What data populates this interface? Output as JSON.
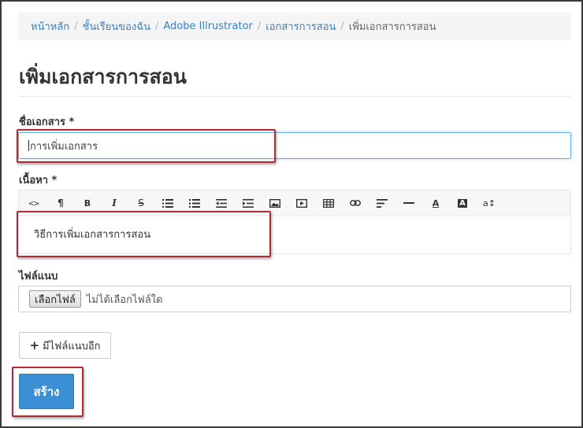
{
  "breadcrumb": {
    "items": [
      "หน้าหลัก",
      "ชั้นเรียนของฉัน",
      "Adobe Illrustrator",
      "เอกสารการสอน"
    ],
    "current": "เพิ่มเอกสารการสอน"
  },
  "page_title": "เพิ่มเอกสารการสอน",
  "form": {
    "name_label": "ชื่อเอกสาร *",
    "name_value": "การเพิ่มเอกสาร",
    "content_label": "เนื้อหา *",
    "content_value": "วิธีการเพิ่มเอกสารการสอน",
    "attachment_label": "ไฟล์แนบ",
    "file_button_label": "เลือกไฟล์",
    "file_status": "ไม่ได้เลือกไฟล์ใด",
    "more_files_label": "มีไฟล์แนบอีก",
    "submit_label": "สร้าง"
  },
  "toolbar": {
    "code": "<>",
    "paragraph": "¶",
    "bold": "B",
    "italic": "I",
    "strike": "S",
    "font_color": "A",
    "bg_color": "A",
    "font_size": "a↕"
  },
  "colors": {
    "link": "#3a7fc3",
    "primary_button": "#3b8fd4",
    "highlight_box": "#b02a37"
  }
}
